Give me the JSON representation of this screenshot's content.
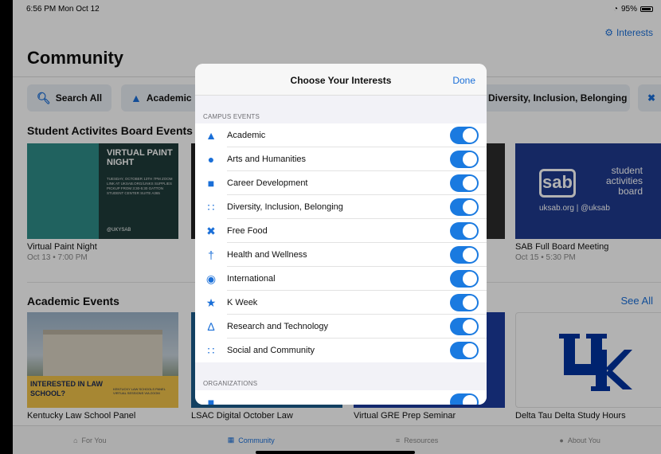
{
  "status": {
    "time": "6:56 PM  Mon Oct 12",
    "battery": "95%"
  },
  "header": {
    "title": "Community",
    "interests_label": "Interests"
  },
  "chips": [
    {
      "label": "Search All",
      "icon": "search-icon"
    },
    {
      "label": "Academic",
      "icon": "graduation-cap-icon"
    }
  ],
  "chip_right": {
    "label": "Diversity, Inclusion, Belonging"
  },
  "sections": {
    "sab": {
      "title": "Student Activites Board Events"
    },
    "academic": {
      "title": "Academic Events",
      "see_all": "See All"
    }
  },
  "sab_cards": [
    {
      "title": "Virtual Paint Night",
      "subtitle": "Oct 13 • 7:00 PM",
      "poster_title": "VIRTUAL PAINT NIGHT",
      "poster_text": "TUESDAY, OCTOBER 13TH 7PM ZOOM LINK AT UKSAB.ORG/LINKS SUPPLIES PICKUP FROM 3:30-5:30 GATTON STUDENT CENTER SUITE A365",
      "poster_handle": "@UKYSAB"
    },
    {
      "title": "SAB Full Board Meeting",
      "subtitle": "Oct 15 • 5:30 PM",
      "logo_sab": "sab",
      "logo_lines": [
        "student",
        "activities",
        "board"
      ],
      "logo_url": "uksab.org | @uksab"
    }
  ],
  "academic_cards": [
    {
      "title": "Kentucky Law School Panel",
      "banner": "INTERESTED IN LAW SCHOOL?",
      "banner_small": "KENTUCKY LAW SCHOOLS PANEL VIRTUAL SESSIONS VIA ZOOM"
    },
    {
      "title": "LSAC Digital October Law"
    },
    {
      "title": "Virtual GRE Prep Seminar"
    },
    {
      "title": "Delta Tau Delta Study Hours"
    }
  ],
  "modal": {
    "title": "Choose Your Interests",
    "done_label": "Done",
    "group_campus": "CAMPUS EVENTS",
    "group_orgs": "ORGANIZATIONS",
    "interests": [
      {
        "label": "Academic",
        "icon": "graduation-cap-icon",
        "on": true
      },
      {
        "label": "Arts and Humanities",
        "icon": "palette-icon",
        "on": true
      },
      {
        "label": "Career Development",
        "icon": "briefcase-icon",
        "on": true
      },
      {
        "label": "Diversity, Inclusion, Belonging",
        "icon": "people-group-icon",
        "on": true
      },
      {
        "label": "Free Food",
        "icon": "utensils-icon",
        "on": true
      },
      {
        "label": "Health and Wellness",
        "icon": "running-person-icon",
        "on": true
      },
      {
        "label": "International",
        "icon": "globe-icon",
        "on": true
      },
      {
        "label": "K Week",
        "icon": "star-icon",
        "on": true
      },
      {
        "label": "Research and Technology",
        "icon": "flask-icon",
        "on": true
      },
      {
        "label": "Social and Community",
        "icon": "users-icon",
        "on": true
      }
    ]
  },
  "tabs": [
    {
      "label": "For You",
      "icon": "home-icon",
      "active": false
    },
    {
      "label": "Community",
      "icon": "map-icon",
      "active": true
    },
    {
      "label": "Resources",
      "icon": "layers-icon",
      "active": false
    },
    {
      "label": "About You",
      "icon": "person-icon",
      "active": false
    }
  ],
  "colors": {
    "accent": "#1a6fd8",
    "toggle_on": "#1a7ae0",
    "uk_blue": "#0033a0"
  }
}
